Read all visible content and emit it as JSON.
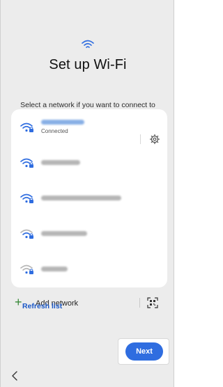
{
  "header": {
    "icon": "wifi-icon",
    "title": "Set up Wi-Fi",
    "subtitle": "Select a network if you want to connect to Wi-Fi now."
  },
  "networks": [
    {
      "ssid": "",
      "status": "Connected",
      "icon": "wifi-lock-icon"
    },
    {
      "ssid": "",
      "status": "",
      "icon": "wifi-lock-icon"
    },
    {
      "ssid": "",
      "status": "",
      "icon": "wifi-lock-icon"
    },
    {
      "ssid": "",
      "status": "",
      "icon": "wifi-lock-icon"
    },
    {
      "ssid": "",
      "status": "",
      "icon": "wifi-lock-icon"
    }
  ],
  "actions": {
    "add_network": "Add network",
    "refresh": "Refresh list",
    "next": "Next"
  },
  "colors": {
    "accent": "#2f6de0",
    "link": "#1a58c7",
    "add_plus": "#3a8a3a",
    "background": "#ececec"
  }
}
